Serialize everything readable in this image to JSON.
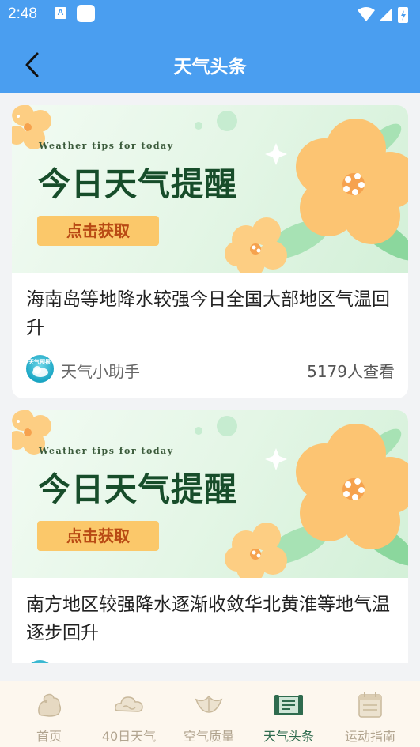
{
  "status_bar": {
    "time": "2:48",
    "notification_letter": "A"
  },
  "header": {
    "title": "天气头条"
  },
  "articles": [
    {
      "banner": {
        "tagline": "Weather tips for today",
        "headline": "今日天气提醒",
        "button": "点击获取"
      },
      "title": "海南岛等地降水较强今日全国大部地区气温回升",
      "author": "天气小助手",
      "avatar_text": "天气预报",
      "views": "5179人查看"
    },
    {
      "banner": {
        "tagline": "Weather tips for today",
        "headline": "今日天气提醒",
        "button": "点击获取"
      },
      "title": "南方地区较强降水逐渐收敛华北黄淮等地气温逐步回升"
    }
  ],
  "tabs": [
    {
      "label": "首页",
      "icon": "home-icon"
    },
    {
      "label": "40日天气",
      "icon": "cloud-icon"
    },
    {
      "label": "空气质量",
      "icon": "leaf-icon"
    },
    {
      "label": "天气头条",
      "icon": "news-scroll-icon",
      "active": true
    },
    {
      "label": "运动指南",
      "icon": "calendar-icon"
    }
  ],
  "colors": {
    "header_blue": "#4a9ef0",
    "tab_active": "#2f6b4e",
    "tab_inactive": "#b2a590",
    "banner_button": "#fbc86a"
  }
}
